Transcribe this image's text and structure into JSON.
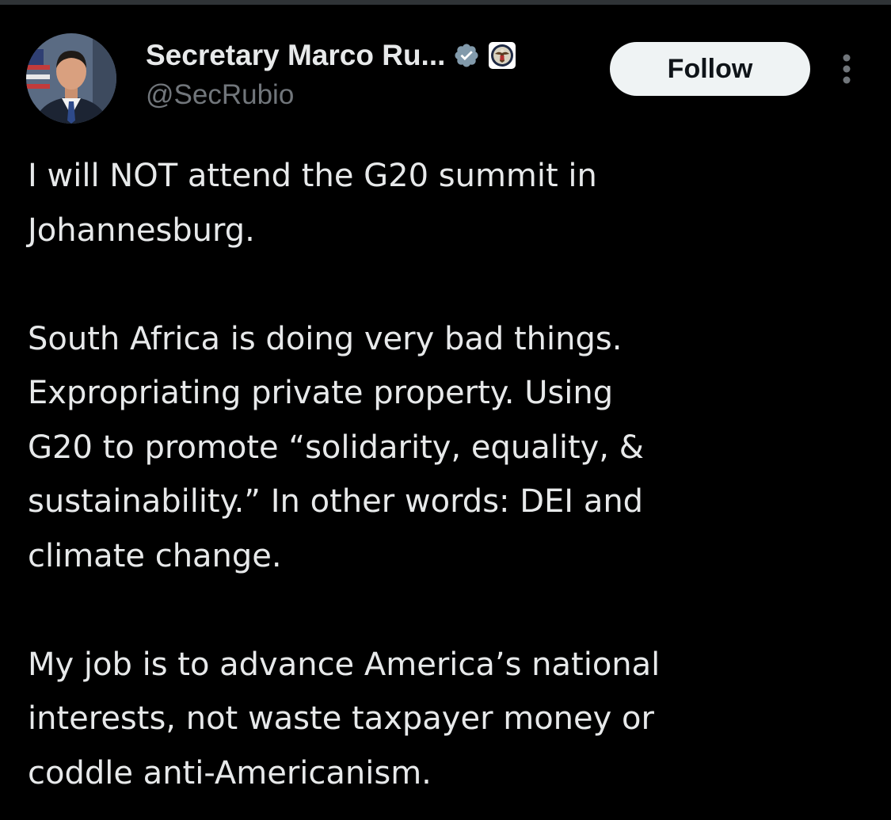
{
  "tweet": {
    "author": {
      "display_name": "Secretary Marco Ru...",
      "handle": "@SecRubio",
      "avatar_icon": "profile-photo",
      "verified_icon": "verified-badge-icon",
      "affiliate_icon": "state-department-seal-icon",
      "verified_color": "#1d9bf0"
    },
    "follow_label": "Follow",
    "more_icon": "more-options-icon",
    "paragraphs": [
      "I will NOT attend the G20 summit in\nJohannesburg.",
      "South Africa is doing very bad things.\nExpropriating private property. Using\nG20 to promote “solidarity, equality, &\nsustainability.” In other words: DEI and\nclimate change.",
      "My job is to advance America’s national\ninterests, not waste taxpayer money or\ncoddle anti-Americanism."
    ]
  },
  "theme": {
    "background": "#000000",
    "text": "#e7e9ea",
    "secondary_text": "#71767b",
    "button_bg": "#eff3f4",
    "button_text": "#0f1419"
  }
}
